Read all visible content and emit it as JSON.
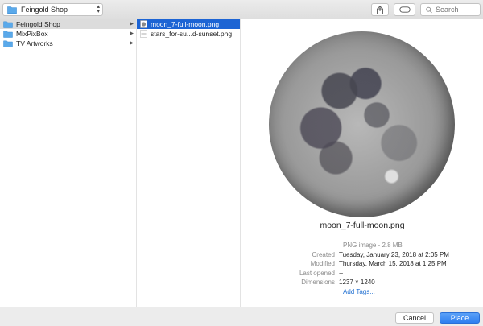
{
  "toolbar": {
    "location": "Feingold Shop",
    "search_placeholder": "Search"
  },
  "sidebar": {
    "items": [
      {
        "label": "Feingold Shop",
        "selected": true
      },
      {
        "label": "MixPixBox",
        "selected": false
      },
      {
        "label": "TV Artworks",
        "selected": false
      }
    ]
  },
  "files": {
    "items": [
      {
        "label": "moon_7-full-moon.png",
        "selected": true
      },
      {
        "label": "stars_for-su...d-sunset.png",
        "selected": false
      }
    ]
  },
  "preview": {
    "name": "moon_7-full-moon.png",
    "kind": "PNG image - 2.8 MB",
    "created_label": "Created",
    "created_value": "Tuesday, January 23, 2018 at 2:05 PM",
    "modified_label": "Modified",
    "modified_value": "Thursday, March 15, 2018 at 1:25 PM",
    "last_opened_label": "Last opened",
    "last_opened_value": "--",
    "dimensions_label": "Dimensions",
    "dimensions_value": "1237 × 1240",
    "add_tags": "Add Tags..."
  },
  "buttons": {
    "cancel": "Cancel",
    "place": "Place"
  },
  "colors": {
    "selection": "#1c64d4",
    "folder": "#5aa9ea",
    "link": "#1f6fd1"
  }
}
